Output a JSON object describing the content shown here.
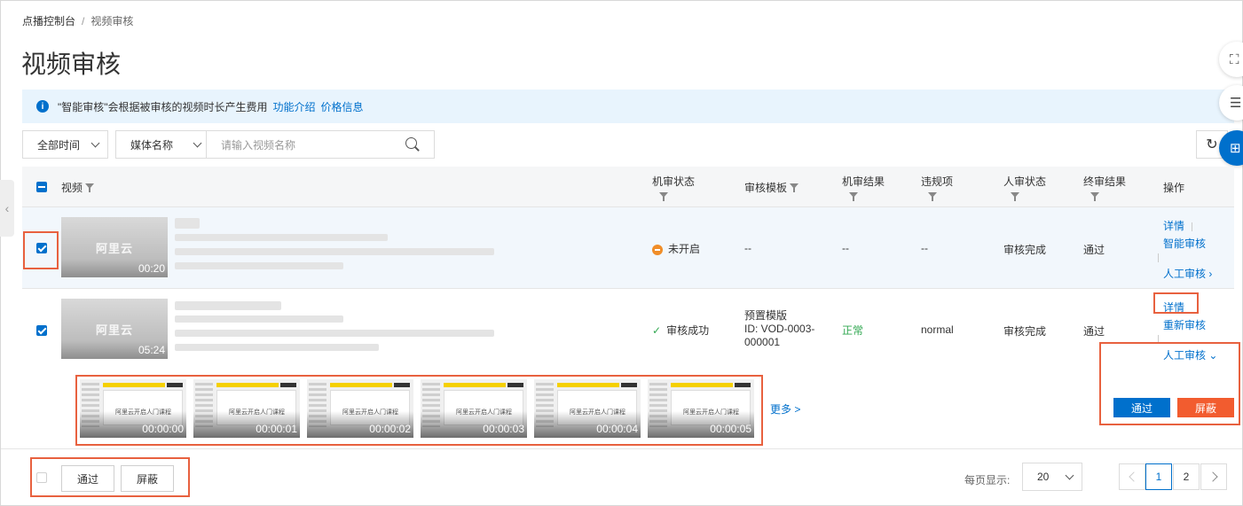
{
  "breadcrumb": {
    "root": "点播控制台",
    "sep": "/",
    "current": "视频审核"
  },
  "page_title": "视频审核",
  "notice": {
    "text": "\"智能审核\"会根据被审核的视频时长产生费用",
    "link1": "功能介绍",
    "link2": "价格信息"
  },
  "filters": {
    "time": "全部时间",
    "media_field": "媒体名称",
    "search_placeholder": "请输入视频名称"
  },
  "columns": {
    "video": "视频",
    "machine_status": "机审状态",
    "template": "审核模板",
    "machine_result": "机审结果",
    "violation": "违规项",
    "human_status": "人审状态",
    "final_result": "终审结果",
    "ops": "操作"
  },
  "rows": [
    {
      "logo": "阿里云",
      "duration": "00:20",
      "machine_status": "未开启",
      "template": "--",
      "machine_result": "--",
      "violation": "--",
      "human_status": "审核完成",
      "final_result": "通过",
      "op_detail": "详情",
      "op_smart": "智能审核",
      "op_human": "人工审核 ›"
    },
    {
      "logo": "阿里云",
      "duration": "05:24",
      "machine_status": "审核成功",
      "template": "预置模版",
      "template_id_1": "ID: VOD-0003-",
      "template_id_2": "000001",
      "machine_result": "正常",
      "violation": "normal",
      "human_status": "审核完成",
      "final_result": "通过",
      "op_detail": "详情",
      "op_recheck": "重新审核",
      "op_human": "人工审核 ⌄"
    }
  ],
  "frames": [
    {
      "time": "00:00:00"
    },
    {
      "time": "00:00:01"
    },
    {
      "time": "00:00:02"
    },
    {
      "time": "00:00:03"
    },
    {
      "time": "00:00:04"
    },
    {
      "time": "00:00:05"
    }
  ],
  "frame_caption": "阿里云开启人门课程",
  "more": "更多 >",
  "review": {
    "pass": "通过",
    "block": "屏蔽"
  },
  "footer": {
    "pass": "通过",
    "block": "屏蔽",
    "page_size_label": "每页显示:",
    "page_size": "20",
    "pages": [
      "1",
      "2"
    ]
  },
  "colors": {
    "primary": "#0070cc",
    "danger": "#f25c2f",
    "highlight": "#e8613f",
    "success": "#32a852"
  }
}
